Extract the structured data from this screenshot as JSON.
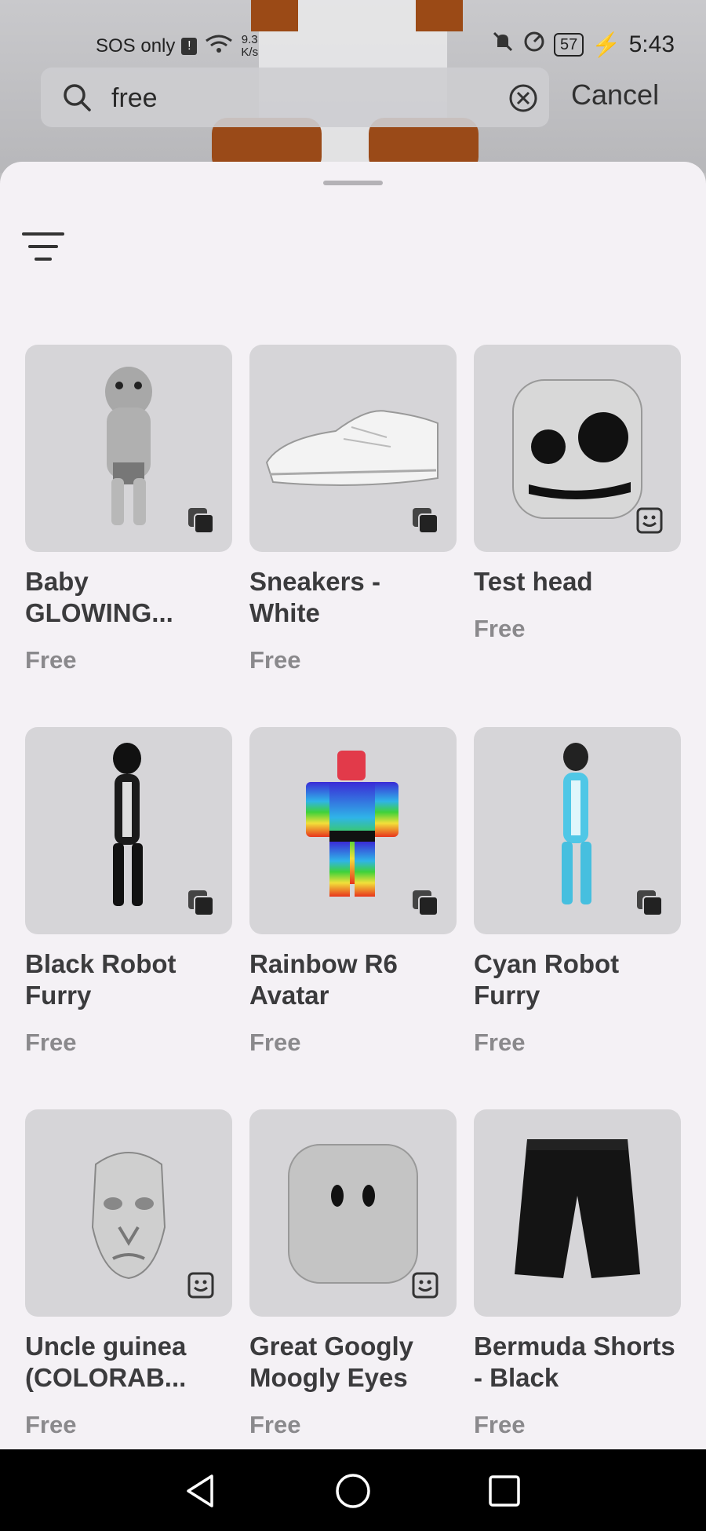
{
  "status_bar": {
    "carrier": "SOS only",
    "net_speed_top": "9.3",
    "net_speed_unit": "K/s",
    "battery": "57",
    "time": "5:43"
  },
  "search": {
    "value": "free",
    "cancel_label": "Cancel"
  },
  "items": [
    {
      "name": "Baby GLOWING...",
      "price": "Free",
      "type_icon": "bundle-icon"
    },
    {
      "name": "Sneakers - White",
      "price": "Free",
      "type_icon": "bundle-icon"
    },
    {
      "name": "Test head",
      "price": "Free",
      "type_icon": "head-icon"
    },
    {
      "name": "Black Robot Furry",
      "price": "Free",
      "type_icon": "bundle-icon"
    },
    {
      "name": "Rainbow R6 Avatar",
      "price": "Free",
      "type_icon": "bundle-icon"
    },
    {
      "name": "Cyan Robot Furry",
      "price": "Free",
      "type_icon": "bundle-icon"
    },
    {
      "name": "Uncle guinea (COLORAB...",
      "price": "Free",
      "type_icon": "head-icon"
    },
    {
      "name": "Great Googly Moogly Eyes",
      "price": "Free",
      "type_icon": "head-icon"
    },
    {
      "name": "Bermuda Shorts - Black",
      "price": "Free",
      "type_icon": "none"
    }
  ]
}
